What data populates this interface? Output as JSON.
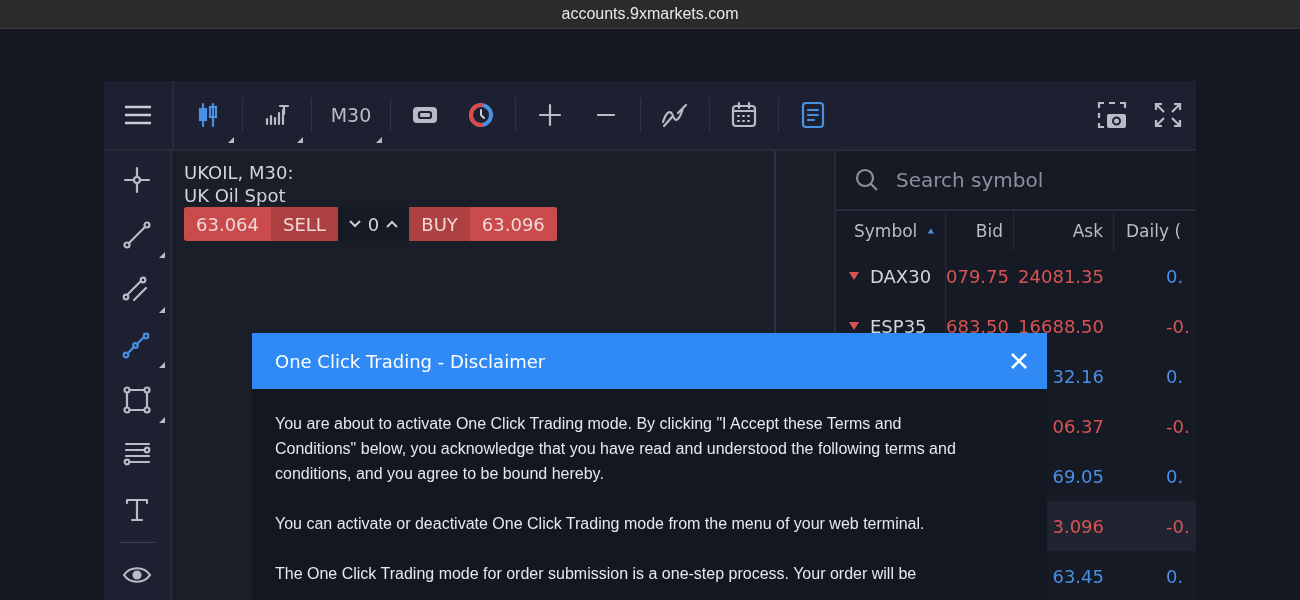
{
  "browser": {
    "url": "accounts.9xmarkets.com"
  },
  "toolbar": {
    "left": [
      {
        "selected": true,
        "has_menu": true
      },
      {
        "selected": false,
        "has_menu": true
      },
      {
        "kind": "text",
        "label": "M30",
        "has_menu": true
      },
      {
        "selected": false
      },
      {
        "kind": "icon"
      },
      {
        "selected": false
      },
      {
        "selected": false
      },
      {
        "selected": false
      },
      {
        "selected": false
      },
      {
        "selected": true
      }
    ],
    "right": [
      {
        "selected": false
      },
      {
        "selected": false
      }
    ]
  },
  "drawing_tools": [
    {
      "selected": false,
      "has_menu": false
    },
    {
      "selected": false,
      "has_menu": true
    },
    {
      "selected": false,
      "has_menu": true
    },
    {
      "selected": true,
      "has_menu": true
    },
    {
      "selected": false,
      "has_menu": true
    },
    {
      "selected": false,
      "has_menu": false
    },
    {
      "selected": false,
      "has_menu": false
    },
    {
      "selected": false,
      "has_menu": false
    }
  ],
  "chart": {
    "symbol_line": "UKOIL, M30:",
    "description": "UK Oil Spot",
    "trade": {
      "sell_price": "63.064",
      "sell_label": "SELL",
      "quantity": "0",
      "buy_label": "BUY",
      "buy_price": "63.096"
    }
  },
  "watchlist": {
    "search": {
      "placeholder": "Search symbol"
    },
    "columns": [
      {
        "label": "Symbol",
        "sorted": true
      },
      {
        "label": "Bid",
        "sorted": false
      },
      {
        "label": "Ask",
        "sorted": false
      },
      {
        "label": "Daily (",
        "sorted": false
      }
    ],
    "rows": [
      {
        "symbol": "DAX30",
        "bid": "079.75",
        "ask": {
          "text": "24081.35",
          "color": "#d85454"
        },
        "daily": {
          "text": "0.",
          "color": "#4a90e2"
        },
        "selected": false
      },
      {
        "symbol": "ESP35",
        "bid": "683.50",
        "ask": {
          "text": "16688.50",
          "color": "#d85454"
        },
        "daily": {
          "text": "-0.",
          "color": "#d85454"
        },
        "selected": false
      },
      {
        "ask": {
          "text": "32.16",
          "color": "#4a90e2"
        },
        "daily": {
          "text": "0.",
          "color": "#4a90e2"
        },
        "selected": false
      },
      {
        "ask": {
          "text": "06.37",
          "color": "#d85454"
        },
        "daily": {
          "text": "-0.",
          "color": "#d85454"
        },
        "selected": false
      },
      {
        "ask": {
          "text": "69.05",
          "color": "#4a90e2"
        },
        "daily": {
          "text": "0.",
          "color": "#4a90e2"
        },
        "selected": false
      },
      {
        "ask": {
          "text": "3.096",
          "color": "#d85454"
        },
        "daily": {
          "text": "-0.",
          "color": "#d85454"
        },
        "selected": true
      },
      {
        "ask": {
          "text": "63.45",
          "color": "#4a90e2"
        },
        "daily": {
          "text": "0.",
          "color": "#4a90e2"
        },
        "selected": false
      }
    ]
  },
  "dialog": {
    "title": "One Click Trading - Disclaimer",
    "paragraphs": [
      "You are about to activate One Click Trading mode. By clicking \"I Accept these Terms and Conditions\" below, you acknowledge that you have read and understood the following terms and conditions, and you agree to be bound hereby.",
      "You can activate or deactivate One Click Trading mode from the menu of your web terminal.",
      "The One Click Trading mode for order submission is a one-step process. Your order will be"
    ]
  }
}
